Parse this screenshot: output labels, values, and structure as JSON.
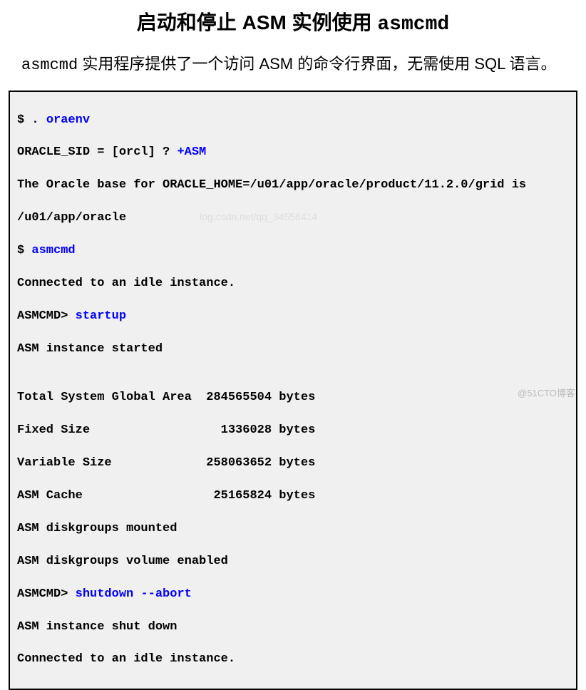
{
  "title": {
    "part1": "启动和停止 ",
    "part2": "ASM",
    "part3": " 实例使用 ",
    "part4": "asmcmd"
  },
  "description": {
    "part1": "asmcmd",
    "part2": " 实用程序提供了一个访问 ASM 的命令行界面，无需使用 SQL 语言。"
  },
  "terminal": {
    "l1a": "$ . ",
    "l1b": "oraenv",
    "l2a": "ORACLE_SID = [orcl] ? ",
    "l2b": "+ASM",
    "l3": "The Oracle base for ORACLE_HOME=/u01/app/oracle/product/11.2.0/grid is",
    "l4": "/u01/app/oracle",
    "l5a": "$ ",
    "l5b": "asmcmd",
    "l6": "Connected to an idle instance.",
    "l7a": "ASMCMD> ",
    "l7b": "startup",
    "l8": "ASM instance started",
    "l9": "",
    "l10": "Total System Global Area  284565504 bytes",
    "l11": "Fixed Size                  1336028 bytes",
    "l12": "Variable Size             258063652 bytes",
    "l13": "ASM Cache                  25165824 bytes",
    "l14": "ASM diskgroups mounted",
    "l15": "ASM diskgroups volume enabled",
    "l16a": "ASMCMD> ",
    "l16b": "shutdown --abort",
    "l17": "ASM instance shut down",
    "l18": "Connected to an idle instance."
  },
  "watermark": "@51CTO博客",
  "watermark_center": "log.csdn.net/qq_34556414"
}
